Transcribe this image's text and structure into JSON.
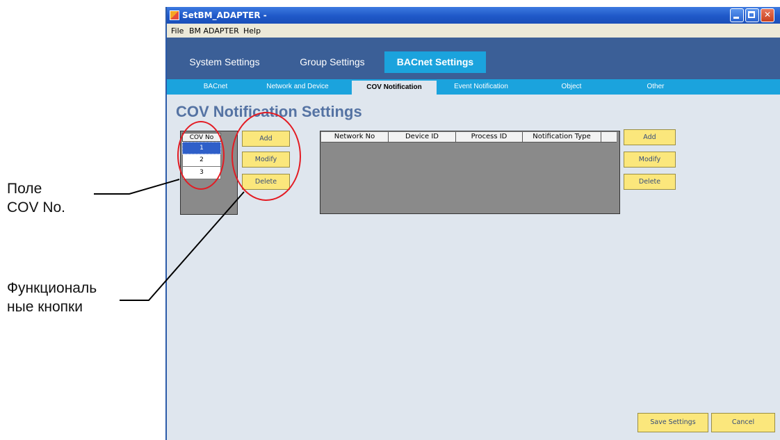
{
  "annotations": {
    "cov_field_line1": "Поле",
    "cov_field_line2": "COV No.",
    "func_buttons_line1": "Функциональ",
    "func_buttons_line2": "ные кнопки"
  },
  "window": {
    "title": "SetBM_ADAPTER -"
  },
  "menu": {
    "file": "File",
    "bm_adapter": "BM ADAPTER",
    "help": "Help"
  },
  "main_tabs": [
    "System Settings",
    "Group Settings",
    "BACnet Settings"
  ],
  "sub_tabs": [
    "BACnet",
    "Network and Device",
    "COV Notification",
    "Event Notification",
    "Object",
    "Other"
  ],
  "page": {
    "title": "COV Notification Settings"
  },
  "cov_list": {
    "header": "COV No",
    "rows": [
      "1",
      "2",
      "3"
    ]
  },
  "left_buttons": {
    "add": "Add",
    "modify": "Modify",
    "delete": "Delete"
  },
  "notification_table": {
    "columns": [
      "Network No",
      "Device ID",
      "Process ID",
      "Notification Type"
    ]
  },
  "right_buttons": {
    "add": "Add",
    "modify": "Modify",
    "delete": "Delete"
  },
  "footer": {
    "save": "Save Settings",
    "cancel": "Cancel"
  },
  "colors": {
    "accent_blue": "#1ba3dd",
    "tab_bar": "#3b5f97",
    "button_yellow": "#fbe77c",
    "annotation_red": "#e31b23"
  }
}
